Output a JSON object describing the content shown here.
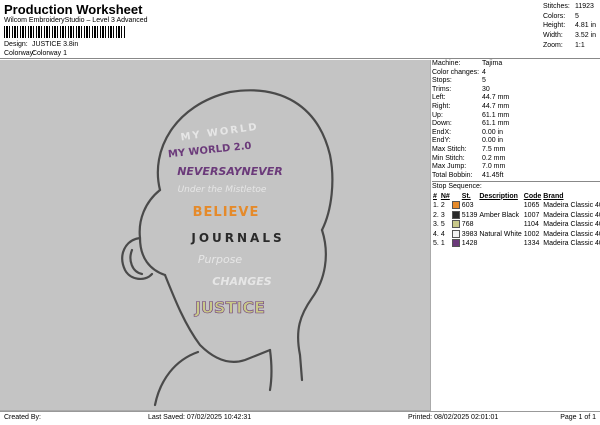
{
  "header": {
    "title": "Production Worksheet",
    "subtitle": "Wilcom EmbroideryStudio – Level 3 Advanced",
    "design_label": "Design:",
    "design_value": "JUSTICE 3.8in",
    "colorway_label": "Colorway:",
    "colorway_value": "Colorway 1"
  },
  "summary": [
    {
      "label": "Stitches:",
      "value": "11923"
    },
    {
      "label": "Colors:",
      "value": "5"
    },
    {
      "label": "Height:",
      "value": "4.81 in"
    },
    {
      "label": "Width:",
      "value": "3.52 in"
    },
    {
      "label": "Zoom:",
      "value": "1:1"
    }
  ],
  "design_text": {
    "line1": "MY WORLD",
    "line2": "MY WORLD 2.0",
    "line3": "NEVERSAYNEVER",
    "line4": "Under the Mistletoe",
    "line5": "BELIEVE",
    "line6": "JOURNALS",
    "line7": "Purpose",
    "line8": "CHANGES",
    "line9": "JUSTICE"
  },
  "info": [
    {
      "label": "Machine:",
      "value": "Tajima"
    },
    {
      "label": "Color changes:",
      "value": "4"
    },
    {
      "label": "Stops:",
      "value": "5"
    },
    {
      "label": "Trims:",
      "value": "30"
    },
    {
      "label": "Left:",
      "value": "44.7 mm"
    },
    {
      "label": "Right:",
      "value": "44.7 mm"
    },
    {
      "label": "Up:",
      "value": "61.1 mm"
    },
    {
      "label": "Down:",
      "value": "61.1 mm"
    },
    {
      "label": "EndX:",
      "value": "0.00 in"
    },
    {
      "label": "EndY:",
      "value": "0.00 in"
    },
    {
      "label": "Max Stitch:",
      "value": "7.5 mm"
    },
    {
      "label": "Min Stitch:",
      "value": "0.2 mm"
    },
    {
      "label": "Max Jump:",
      "value": "7.0 mm"
    },
    {
      "label": "Total Bobbin:",
      "value": "41.45ft"
    }
  ],
  "stops": {
    "heading": "Stop Sequence:",
    "columns": [
      "#",
      "N#",
      "St.",
      "Description",
      "Code",
      "Brand"
    ],
    "rows": [
      {
        "num": "1.",
        "n": "2",
        "color": "#e58a2a",
        "st": "603",
        "desc": "",
        "code": "1065",
        "brand": "Madeira Classic 40"
      },
      {
        "num": "2.",
        "n": "3",
        "color": "#2a2a2a",
        "st": "5139",
        "desc": "Amber Black",
        "code": "1007",
        "brand": "Madeira Classic 40"
      },
      {
        "num": "3.",
        "n": "5",
        "color": "#c9c98a",
        "st": "768",
        "desc": "",
        "code": "1104",
        "brand": "Madeira Classic 40"
      },
      {
        "num": "4.",
        "n": "4",
        "color": "#f2f2f2",
        "st": "3983",
        "desc": "Natural White",
        "code": "1002",
        "brand": "Madeira Classic 40"
      },
      {
        "num": "5.",
        "n": "1",
        "color": "#6b3a7a",
        "st": "1428",
        "desc": "",
        "code": "1334",
        "brand": "Madeira Classic 40"
      }
    ]
  },
  "footer": {
    "created": "Created By:",
    "saved": "Last Saved: 07/02/2025 10:42:31",
    "printed": "Printed: 08/02/2025 02:01:01",
    "page": "Page 1 of 1"
  }
}
